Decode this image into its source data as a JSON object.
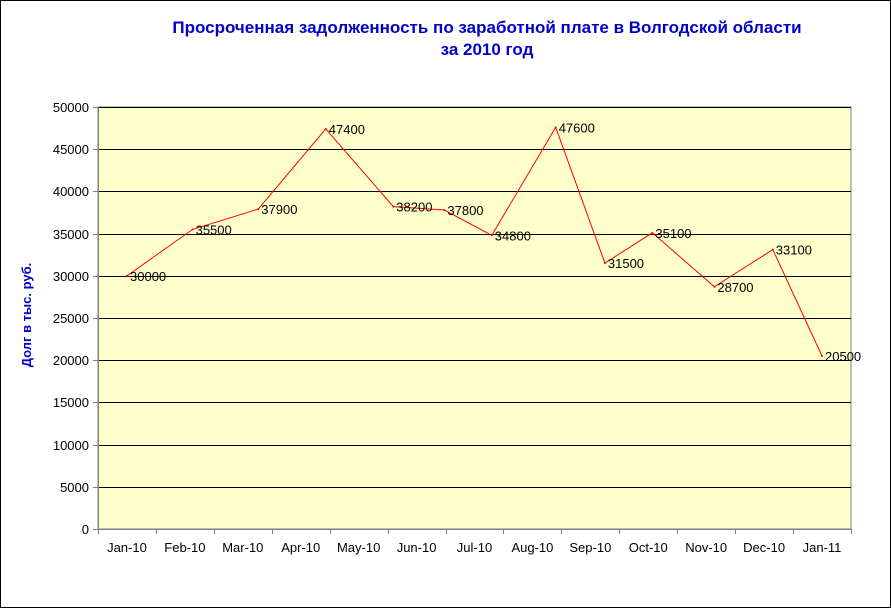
{
  "chart_data": {
    "type": "line",
    "title_line1": "Просроченная задолженность по заработной плате в Волгодской области",
    "title_line2": "за 2010 год",
    "xlabel": "",
    "ylabel": "Долг в тыс. руб.",
    "categories": [
      "Jan-10",
      "Feb-10",
      "Mar-10",
      "Apr-10",
      "May-10",
      "Jun-10",
      "Jul-10",
      "Aug-10",
      "Sep-10",
      "Oct-10",
      "Nov-10",
      "Dec-10",
      "Jan-11"
    ],
    "x_dates": [
      "2010-01-01",
      "2010-02-06",
      "2010-03-14",
      "2010-04-20",
      "2010-05-27",
      "2010-06-24",
      "2010-07-20",
      "2010-08-24",
      "2010-09-20",
      "2010-10-16",
      "2010-11-19",
      "2010-12-21",
      "2011-01-17"
    ],
    "series": [
      {
        "color": "#ff0000",
        "values": [
          30000,
          35500,
          37900,
          47400,
          38200,
          37800,
          34800,
          47600,
          31500,
          35100,
          28700,
          33100,
          20500
        ]
      }
    ],
    "ylim": [
      0,
      50000
    ],
    "yticks": [
      0,
      5000,
      10000,
      15000,
      20000,
      25000,
      30000,
      35000,
      40000,
      45000,
      50000
    ],
    "grid": true,
    "plot_background": "#ffffcc",
    "title_color": "#0000cc"
  }
}
